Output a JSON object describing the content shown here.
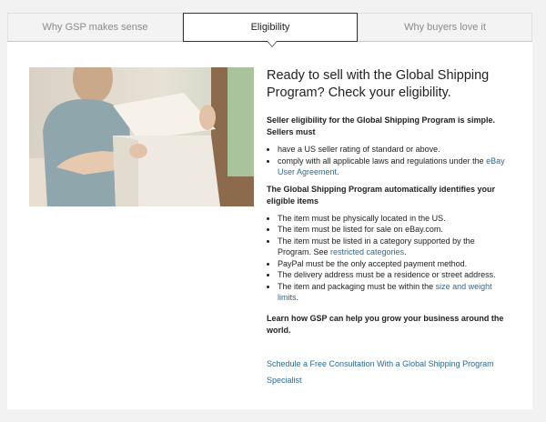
{
  "tabs": [
    {
      "label": "Why GSP makes sense"
    },
    {
      "label": "Eligibility"
    },
    {
      "label": "Why buyers love it"
    }
  ],
  "heading": "Ready to sell with the Global Shipping Program? Check your eligibility.",
  "seller_section": {
    "intro": "Seller eligibility for the Global Shipping Program is simple. Sellers must",
    "items": [
      {
        "text": "have a US seller rating of standard or above."
      },
      {
        "text": "comply with all applicable laws and regulations under the ",
        "link": "eBay User Agreement",
        "after": "."
      }
    ]
  },
  "item_section": {
    "intro": "The Global Shipping Program automatically identifies your eligible items",
    "items": [
      {
        "text": "The item must be physically located in the US."
      },
      {
        "text": "The item must be listed for sale on eBay.com."
      },
      {
        "text": "The item must be listed in a category supported by the Program. See ",
        "link": "restricted categories",
        "after": "."
      },
      {
        "text": "PayPal must be the only accepted payment method."
      },
      {
        "text": "The delivery address must be a residence or street address."
      },
      {
        "text": "The item and packaging must be within the ",
        "link": "size and weight limits",
        "after": "."
      }
    ]
  },
  "learn_more": "Learn how GSP can help you grow your business around the world.",
  "cta_link": "Schedule a Free Consultation With a Global Shipping Program Specialist",
  "colors": {
    "link": "#2a6a92",
    "background": "#f2f2f2"
  }
}
